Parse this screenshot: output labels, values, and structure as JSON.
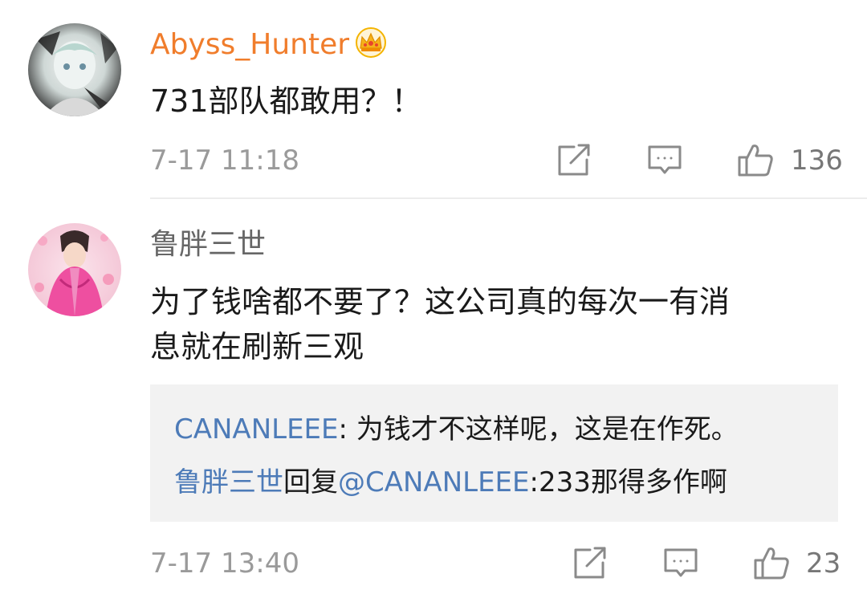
{
  "comments": [
    {
      "username": "Abyss_Hunter",
      "vip_badge": "crown-icon",
      "text_lines": [
        "731部队都敢用？！"
      ],
      "timestamp": "7-17 11:18",
      "likes": "136"
    },
    {
      "username": "鲁胖三世",
      "text_lines": [
        "为了钱啥都不要了？这公司真的每次一有消",
        "息就在刷新三观"
      ],
      "timestamp": "7-17 13:40",
      "likes": "23",
      "replies": [
        {
          "author": "CANANLEEE",
          "separator": ": ",
          "text": "为钱才不这样呢，这是在作死。"
        },
        {
          "author": "鲁胖三世",
          "action": "回复",
          "mention": "@CANANLEEE",
          "separator": ":",
          "text": "233那得多作啊"
        }
      ]
    }
  ],
  "colors": {
    "vip_username": "#f07d2c",
    "username": "#666666",
    "link": "#4d7bb8",
    "text": "#1a1a1a",
    "meta": "#9a9a9a",
    "reply_background": "#f2f2f2"
  },
  "icons": {
    "repost": "repost-icon",
    "comment": "comment-icon",
    "like": "like-icon"
  }
}
